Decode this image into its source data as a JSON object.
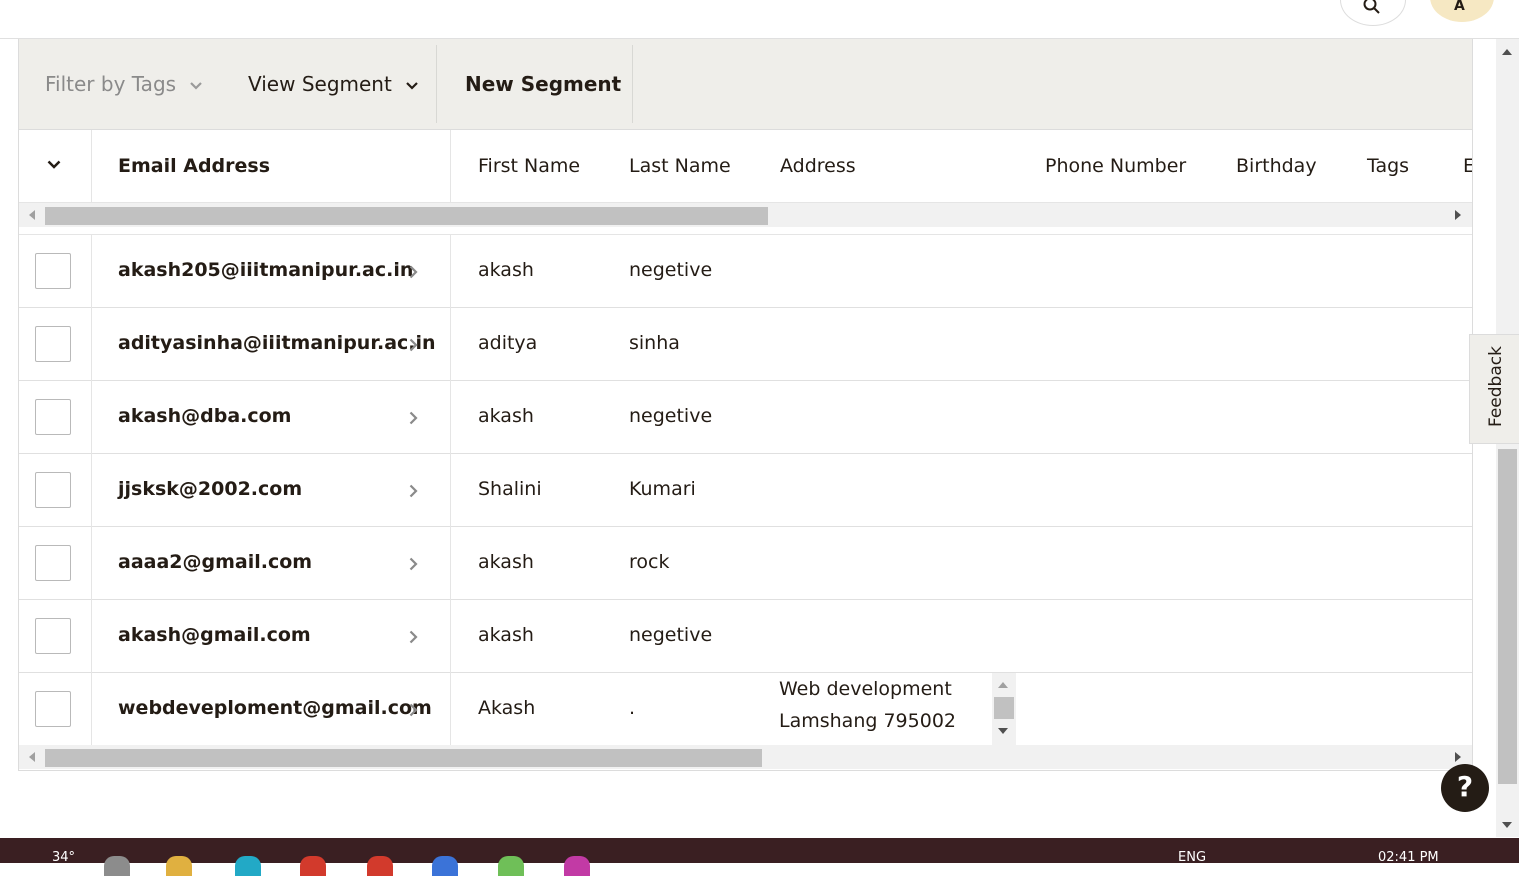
{
  "toolbar": {
    "filter_by_tags": "Filter by Tags",
    "view_segment": "View Segment",
    "new_segment": "New Segment"
  },
  "columns": {
    "email": "Email Address",
    "first_name": "First Name",
    "last_name": "Last Name",
    "address": "Address",
    "phone": "Phone Number",
    "birthday": "Birthday",
    "tags": "Tags",
    "partial": "E"
  },
  "contacts": [
    {
      "email": "akash205@iiitmanipur.ac.in",
      "first": "akash",
      "last": "negetive"
    },
    {
      "email": "adityasinha@iiitmanipur.ac.in",
      "first": "aditya",
      "last": "sinha"
    },
    {
      "email": "akash@dba.com",
      "first": "akash",
      "last": "negetive"
    },
    {
      "email": "jjsksk@2002.com",
      "first": "Shalini",
      "last": "Kumari"
    },
    {
      "email": "aaaa2@gmail.com",
      "first": "akash",
      "last": "rock"
    },
    {
      "email": "akash@gmail.com",
      "first": "akash",
      "last": "negetive"
    },
    {
      "email": "webdeveploment@gmail.com",
      "first": "Akash",
      "last": ".",
      "address_lines": [
        "Web development",
        "Lamshang 795002"
      ]
    }
  ],
  "feedback_label": "Feedback",
  "help_label": "?",
  "avatar_initial": "A",
  "taskbar": {
    "weather": "34°",
    "language": "ENG",
    "time": "02:41 PM"
  },
  "colors": {
    "toolbar_bg": "#efeeea",
    "text": "#241c15",
    "help_bg": "#241c15",
    "taskbar_bg": "#3a1f22"
  }
}
